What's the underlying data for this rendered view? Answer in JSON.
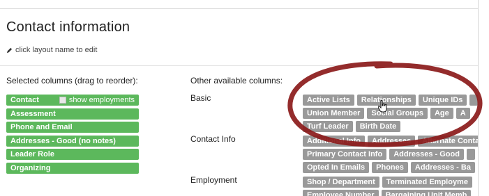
{
  "page": {
    "title": "Contact information",
    "edit_hint": "click layout name to edit"
  },
  "selected": {
    "heading": "Selected columns (drag to reorder):",
    "items": [
      {
        "label": "Contact",
        "option": "show employments"
      },
      {
        "label": "Assessment"
      },
      {
        "label": "Phone and Email"
      },
      {
        "label": "Addresses - Good (no notes)"
      },
      {
        "label": "Leader Role"
      },
      {
        "label": "Organizing"
      }
    ]
  },
  "available": {
    "heading": "Other available columns:",
    "groups": [
      {
        "label": "Basic",
        "rows": [
          [
            "Active Lists",
            "Relationships",
            "Unique IDs",
            ""
          ],
          [
            "Union Member",
            "Social Groups",
            "Age",
            "A"
          ],
          [
            "Turf Leader",
            "Birth Date"
          ]
        ]
      },
      {
        "label": "Contact Info",
        "rows": [
          [
            "Additional Info",
            "Addresses",
            "Alternate Contact"
          ],
          [
            "Primary Contact Info",
            "Addresses - Good",
            ""
          ],
          [
            "Opted In Emails",
            "Phones",
            "Addresses - Ba"
          ]
        ]
      },
      {
        "label": "Employment",
        "rows": [
          [
            "Shop / Department",
            "Terminated Employme"
          ],
          [
            "Employee Number",
            "Bargaining Unit Memb"
          ]
        ]
      }
    ]
  },
  "colors": {
    "selected_chip": "#5cb85c",
    "available_chip": "#999999",
    "annotation_circle": "#8b1a1a"
  },
  "icons": [
    "pencil-icon",
    "checkbox-icon",
    "hand-cursor-icon"
  ]
}
